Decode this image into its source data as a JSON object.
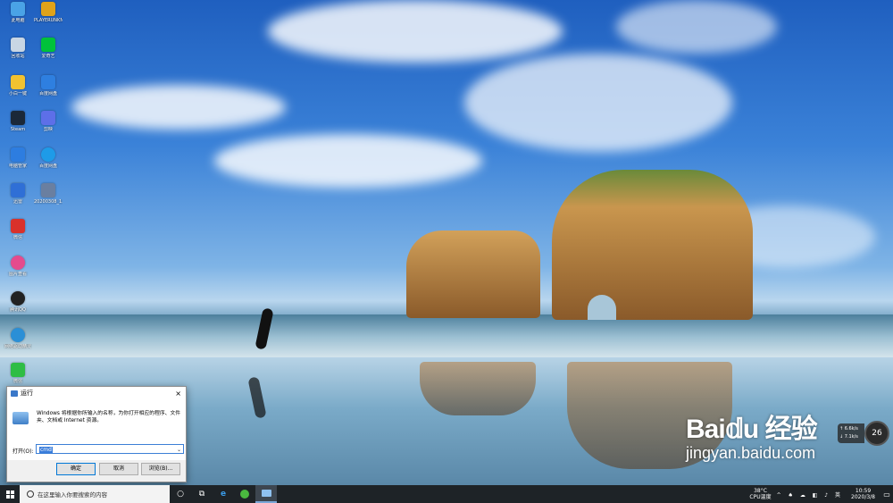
{
  "desktop": {
    "icons": [
      {
        "label": "此电脑",
        "color": "#4aa3e6"
      },
      {
        "label": "回收站",
        "color": "#c8d6e4"
      },
      {
        "label": "小白一键",
        "color": "#f2c230"
      },
      {
        "label": "Steam",
        "color": "#1b2838"
      },
      {
        "label": "电脑管家",
        "color": "#2d7de0"
      },
      {
        "label": "迅雷",
        "color": "#2f6fd6"
      },
      {
        "label": "微信",
        "color": "#d9312b"
      },
      {
        "label": "图片查看",
        "color": "#e54b8d"
      },
      {
        "label": "腾讯QQ",
        "color": "#222222"
      },
      {
        "label": "网络驱动精灵",
        "color": "#2b8fd6"
      },
      {
        "label": "微信",
        "color": "#2ebd45"
      },
      {
        "label": "PLAYERUNKNOWN'S BATTLEGR...",
        "color": "#e0a31a"
      },
      {
        "label": "爱奇艺",
        "color": "#00c23a"
      },
      {
        "label": "百度网盘",
        "color": "#2e7fe0"
      },
      {
        "label": "剪映",
        "color": "#5d6fe8"
      },
      {
        "label": "百度网盘",
        "color": "#1e9be8"
      },
      {
        "label": "20200308_1...",
        "color": "#6a7fa0"
      }
    ]
  },
  "run_dialog": {
    "title": "运行",
    "close": "×",
    "description": "Windows 将根据你所输入的名称，为你打开相应的程序、文件夹、文档或 Internet 资源。",
    "open_label": "打开(O):",
    "input_value": "cmd",
    "dropdown": "⌄",
    "ok": "确定",
    "cancel": "取消",
    "browse": "浏览(B)..."
  },
  "watermark": {
    "logo": "Bai𝕕u 经验",
    "url": "jingyan.baidu.com"
  },
  "network_widget": {
    "up": "↑ 6.6k/s",
    "down": "↓ 7.1k/s",
    "gauge": "26"
  },
  "taskbar": {
    "search_placeholder": "在这里输入你要搜索的内容",
    "temp": "38°C",
    "cpu": "CPU温度",
    "tray_icons": "^ ♠ ☁ ◧ ♪ 英",
    "time": "10:59",
    "date": "2020/3/8"
  }
}
